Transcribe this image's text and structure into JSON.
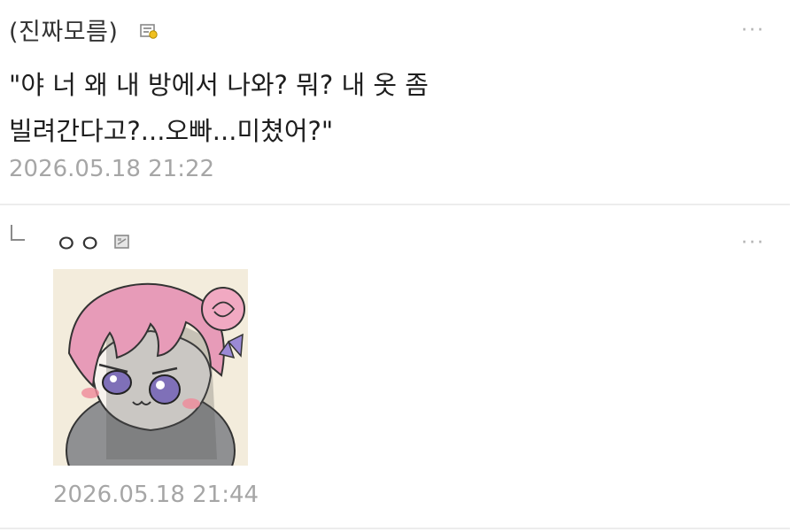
{
  "comment1": {
    "author": "(진짜모름)",
    "badge_icon": "member-badge-icon",
    "more": "···",
    "line1": "\"야 너 왜 내 방에서 나와? 뭐? 내 옷 좀",
    "line2": "빌려간다고?...오빠...미쳤어?\"",
    "date": "2026.05.18 21:22"
  },
  "comment2": {
    "reply_icon": "reply-arrow-icon",
    "author": "ㅇㅇ",
    "badge_icon": "guest-badge-icon",
    "more": "···",
    "sticker_icon": "anime-girl-sticker",
    "date": "2026.05.18 21:44"
  },
  "colors": {
    "date": "#a6a6a6",
    "divider": "#ececec",
    "more": "#b0b0b0"
  }
}
